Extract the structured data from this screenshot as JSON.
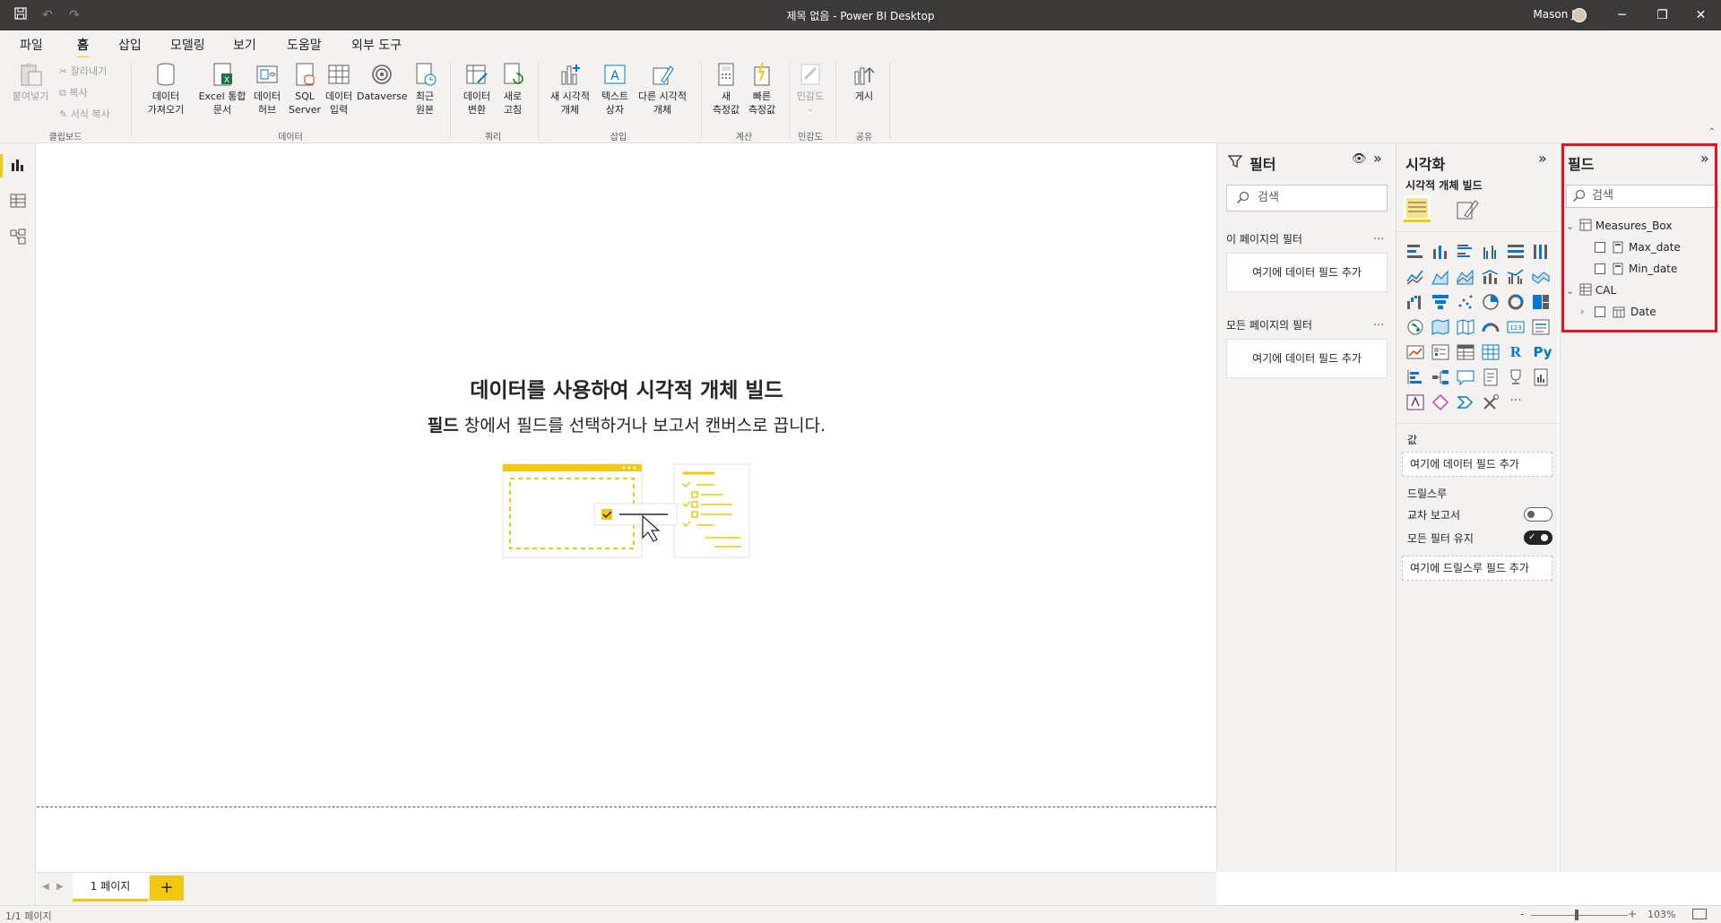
{
  "window": {
    "title": "제목 없음 - Power BI Desktop",
    "user_name": "Mason Jo",
    "minimize_icon": "─",
    "restore_icon": "❐",
    "close_icon": "✕"
  },
  "menu": {
    "items": [
      "파일",
      "홈",
      "삽입",
      "모델링",
      "보기",
      "도움말",
      "외부 도구"
    ],
    "active": "홈"
  },
  "ribbon": {
    "clipboard": {
      "paste": "붙여넣기",
      "cut": "잘라내기",
      "copy": "복사",
      "format_painter": "서식 복사",
      "group": "클립보드"
    },
    "data": {
      "get_data_1": "데이터",
      "get_data_2": "가져오기",
      "excel_1": "Excel 통합",
      "excel_2": "문서",
      "hub_1": "데이터",
      "hub_2": "허브",
      "sql_1": "SQL",
      "sql_2": "Server",
      "enter_1": "데이터",
      "enter_2": "입력",
      "dataverse": "Dataverse",
      "recent_1": "최근",
      "recent_2": "원본",
      "group": "데이터"
    },
    "query": {
      "transform_1": "데이터",
      "transform_2": "변환",
      "refresh_1": "새로",
      "refresh_2": "고침",
      "group": "쿼리"
    },
    "insert": {
      "new_visual_1": "새 시각적",
      "new_visual_2": "개체",
      "textbox_1": "텍스트",
      "textbox_2": "상자",
      "more_visuals_1": "다른 시각적",
      "more_visuals_2": "개체",
      "group": "삽입"
    },
    "calc": {
      "new_measure_1": "새",
      "new_measure_2": "측정값",
      "quick_measure_1": "빠른",
      "quick_measure_2": "측정값",
      "group": "계산"
    },
    "sensitivity": {
      "label": "민감도",
      "group": "민감도"
    },
    "share": {
      "publish": "게시",
      "group": "공유"
    }
  },
  "canvas": {
    "heading": "데이터를 사용하여 시각적 개체 빌드",
    "sub_bold": "필드",
    "sub_rest": " 창에서 필드를 선택하거나 보고서 캔버스로 끕니다."
  },
  "pages": {
    "tab": "1 페이지",
    "add": "+",
    "status": "1/1 페이지",
    "zoom": "103%"
  },
  "filters": {
    "title": "필터",
    "search_placeholder": "검색",
    "this_page": "이 페이지의 필터",
    "all_pages": "모든 페이지의 필터",
    "dropzone": "여기에 데이터 필드 추가",
    "more": "..."
  },
  "visualizations": {
    "title": "시각화",
    "build_label": "시각적 개체 빌드",
    "values_label": "값",
    "values_zone": "여기에 데이터 필드 추가",
    "drillthrough_label": "드릴스루",
    "cross_report": "교차 보고서",
    "keep_filters": "모든 필터 유지",
    "drill_zone": "여기에 드릴스루 필드 추가",
    "r_label": "R",
    "py_label": "Py",
    "more_label": "···",
    "accent": "#f2c811"
  },
  "fields": {
    "title": "필드",
    "search_placeholder": "검색",
    "tables": [
      {
        "name": "Measures_Box",
        "items": [
          "Max_date",
          "Min_date"
        ]
      },
      {
        "name": "CAL",
        "items": [
          "Date"
        ]
      }
    ]
  }
}
